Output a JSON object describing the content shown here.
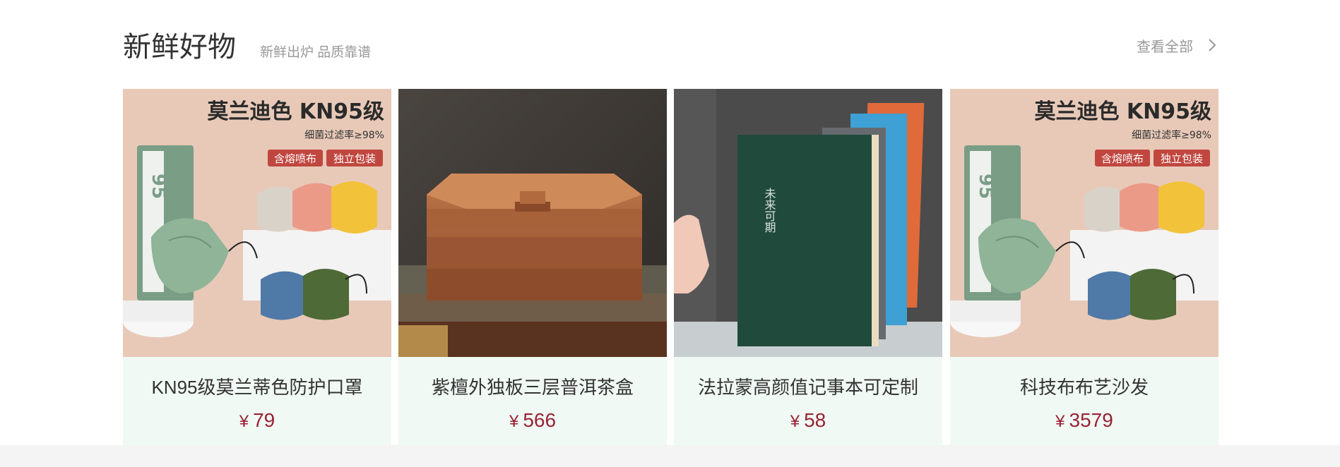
{
  "section": {
    "title": "新鲜好物",
    "subtitle": "新鲜出炉 品质靠谱",
    "view_all_label": "查看全部"
  },
  "colors": {
    "price": "#9a2234",
    "card_bg": "#f0f9f4",
    "title": "#333333",
    "muted": "#999999"
  },
  "products": [
    {
      "name": "KN95级莫兰蒂色防护口罩",
      "currency": "¥",
      "price": "79",
      "image": {
        "headline": "莫兰迪色 KN95级",
        "subline": "细菌过滤率≥98%",
        "tag1": "含熔喷布",
        "tag2": "独立包装",
        "box_label": "95"
      }
    },
    {
      "name": "紫檀外独板三层普洱茶盒",
      "currency": "¥",
      "price": "566"
    },
    {
      "name": "法拉蒙高颜值记事本可定制",
      "currency": "¥",
      "price": "58",
      "image": {
        "cover_text": "未来可期"
      }
    },
    {
      "name": "科技布布艺沙发",
      "currency": "¥",
      "price": "3579",
      "image": {
        "headline": "莫兰迪色 KN95级",
        "subline": "细菌过滤率≥98%",
        "tag1": "含熔喷布",
        "tag2": "独立包装",
        "box_label": "95"
      }
    }
  ]
}
